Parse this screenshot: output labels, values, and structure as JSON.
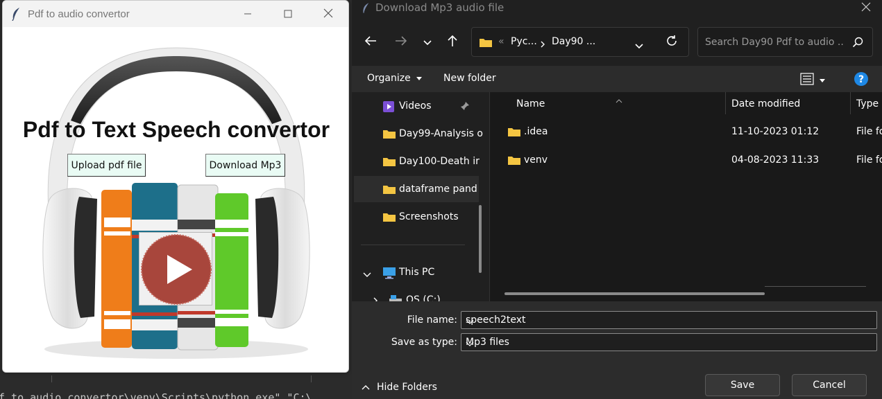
{
  "app_window": {
    "title": "Pdf to audio convertor",
    "heading": "Pdf to Text Speech convertor",
    "upload_button": "Upload pdf file",
    "download_button": "Download Mp3"
  },
  "terminal": {
    "command": "f to audio convertor\\venv\\Scripts\\python.exe\" \"C:\\"
  },
  "dialog": {
    "title": "Download Mp3 audio file",
    "breadcrumb": {
      "overflow": "«",
      "segments": [
        "Pyc...",
        "Day90 ..."
      ]
    },
    "search_placeholder": "Search Day90 Pdf to audio ...",
    "toolbar": {
      "organize": "Organize",
      "new_folder": "New folder"
    },
    "nav_items": [
      {
        "label": "Videos",
        "icon": "videos-icon",
        "pinned": true
      },
      {
        "label": "Day99-Analysis o",
        "icon": "folder-icon"
      },
      {
        "label": "Day100-Death ir",
        "icon": "folder-icon"
      },
      {
        "label": "dataframe pand",
        "icon": "folder-icon",
        "selected": true
      },
      {
        "label": "Screenshots",
        "icon": "folder-icon"
      },
      {
        "label": "This PC",
        "icon": "this-pc-icon"
      },
      {
        "label": "OS (C:)",
        "icon": "drive-icon"
      }
    ],
    "columns": {
      "name": "Name",
      "date_modified": "Date modified",
      "type": "Type"
    },
    "files": [
      {
        "name": ".idea",
        "date": "11-10-2023 01:12",
        "type": "File fo"
      },
      {
        "name": "venv",
        "date": "04-08-2023 11:33",
        "type": "File fo"
      }
    ],
    "file_name_label": "File name:",
    "file_name_value": "speech2text",
    "save_as_type_label": "Save as type:",
    "save_as_type_value": "Mp3 files",
    "hide_folders": "Hide Folders",
    "save_button": "Save",
    "cancel_button": "Cancel"
  },
  "colors": {
    "dialog_bg": "#202020",
    "folder_yellow": "#f4c542",
    "help_blue": "#1e88e5",
    "tk_button_bg": "#e9fbf4",
    "play_red": "#a8463c"
  }
}
